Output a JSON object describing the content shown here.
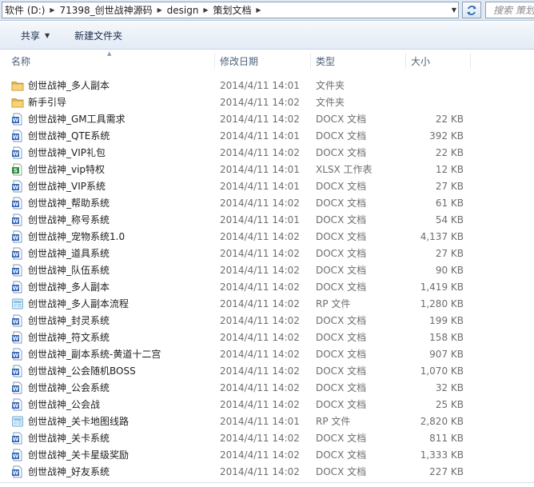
{
  "address": {
    "crumbs": [
      "软件 (D:)",
      "71398_创世战神源码",
      "design",
      "策划文档"
    ],
    "search_placeholder": "搜索 策划..."
  },
  "toolbar": {
    "share_label": "共享",
    "new_folder_label": "新建文件夹"
  },
  "columns": {
    "name": "名称",
    "date": "修改日期",
    "type": "类型",
    "size": "大小"
  },
  "files": [
    {
      "name": "创世战神_多人副本",
      "date": "2014/4/11 14:01",
      "type": "文件夹",
      "size": "",
      "icon": "folder-icon"
    },
    {
      "name": "新手引导",
      "date": "2014/4/11 14:02",
      "type": "文件夹",
      "size": "",
      "icon": "folder-icon"
    },
    {
      "name": "创世战神_GM工具需求",
      "date": "2014/4/11 14:02",
      "type": "DOCX 文档",
      "size": "22 KB",
      "icon": "word-doc-icon"
    },
    {
      "name": "创世战神_QTE系统",
      "date": "2014/4/11 14:01",
      "type": "DOCX 文档",
      "size": "392 KB",
      "icon": "word-doc-icon"
    },
    {
      "name": "创世战神_VIP礼包",
      "date": "2014/4/11 14:02",
      "type": "DOCX 文档",
      "size": "22 KB",
      "icon": "word-doc-icon"
    },
    {
      "name": "创世战神_vip特权",
      "date": "2014/4/11 14:01",
      "type": "XLSX 工作表",
      "size": "12 KB",
      "icon": "excel-sheet-icon"
    },
    {
      "name": "创世战神_VIP系统",
      "date": "2014/4/11 14:01",
      "type": "DOCX 文档",
      "size": "27 KB",
      "icon": "word-doc-icon"
    },
    {
      "name": "创世战神_帮助系统",
      "date": "2014/4/11 14:02",
      "type": "DOCX 文档",
      "size": "61 KB",
      "icon": "word-doc-icon"
    },
    {
      "name": "创世战神_称号系统",
      "date": "2014/4/11 14:01",
      "type": "DOCX 文档",
      "size": "54 KB",
      "icon": "word-doc-icon"
    },
    {
      "name": "创世战神_宠物系统1.0",
      "date": "2014/4/11 14:02",
      "type": "DOCX 文档",
      "size": "4,137 KB",
      "icon": "word-doc-icon"
    },
    {
      "name": "创世战神_道具系统",
      "date": "2014/4/11 14:02",
      "type": "DOCX 文档",
      "size": "27 KB",
      "icon": "word-doc-icon"
    },
    {
      "name": "创世战神_队伍系统",
      "date": "2014/4/11 14:02",
      "type": "DOCX 文档",
      "size": "90 KB",
      "icon": "word-doc-icon"
    },
    {
      "name": "创世战神_多人副本",
      "date": "2014/4/11 14:02",
      "type": "DOCX 文档",
      "size": "1,419 KB",
      "icon": "word-doc-icon"
    },
    {
      "name": "创世战神_多人副本流程",
      "date": "2014/4/11 14:02",
      "type": "RP 文件",
      "size": "1,280 KB",
      "icon": "rp-file-icon"
    },
    {
      "name": "创世战神_封灵系统",
      "date": "2014/4/11 14:02",
      "type": "DOCX 文档",
      "size": "199 KB",
      "icon": "word-doc-icon"
    },
    {
      "name": "创世战神_符文系统",
      "date": "2014/4/11 14:02",
      "type": "DOCX 文档",
      "size": "158 KB",
      "icon": "word-doc-icon"
    },
    {
      "name": "创世战神_副本系统-黄道十二宫",
      "date": "2014/4/11 14:02",
      "type": "DOCX 文档",
      "size": "907 KB",
      "icon": "word-doc-icon"
    },
    {
      "name": "创世战神_公会随机BOSS",
      "date": "2014/4/11 14:02",
      "type": "DOCX 文档",
      "size": "1,070 KB",
      "icon": "word-doc-icon"
    },
    {
      "name": "创世战神_公会系统",
      "date": "2014/4/11 14:02",
      "type": "DOCX 文档",
      "size": "32 KB",
      "icon": "word-doc-icon"
    },
    {
      "name": "创世战神_公会战",
      "date": "2014/4/11 14:02",
      "type": "DOCX 文档",
      "size": "25 KB",
      "icon": "word-doc-icon"
    },
    {
      "name": "创世战神_关卡地图线路",
      "date": "2014/4/11 14:01",
      "type": "RP 文件",
      "size": "2,820 KB",
      "icon": "rp-file-icon"
    },
    {
      "name": "创世战神_关卡系统",
      "date": "2014/4/11 14:02",
      "type": "DOCX 文档",
      "size": "811 KB",
      "icon": "word-doc-icon"
    },
    {
      "name": "创世战神_关卡星级奖励",
      "date": "2014/4/11 14:02",
      "type": "DOCX 文档",
      "size": "1,333 KB",
      "icon": "word-doc-icon"
    },
    {
      "name": "创世战神_好友系统",
      "date": "2014/4/11 14:02",
      "type": "DOCX 文档",
      "size": "227 KB",
      "icon": "word-doc-icon"
    }
  ]
}
